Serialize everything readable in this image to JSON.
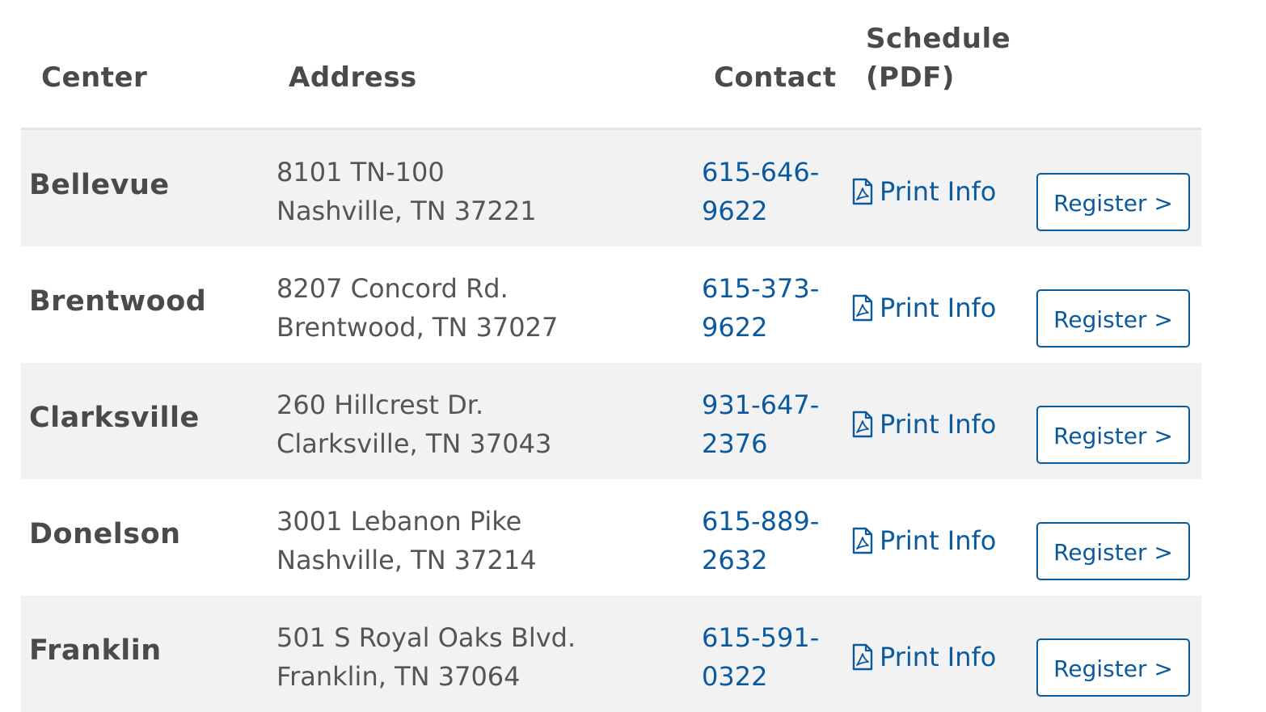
{
  "table": {
    "headers": {
      "center": "Center",
      "address": "Address",
      "contact": "Contact",
      "schedule": "Schedule (PDF)"
    },
    "rows": [
      {
        "name": "Bellevue",
        "address_line1": "8101 TN-100",
        "address_line2": "Nashville, TN 37221",
        "phone_line1": "615-646-",
        "phone_line2": "9622",
        "print_label": "Print Info",
        "register_label": "Register >"
      },
      {
        "name": "Brentwood",
        "address_line1": "8207 Concord Rd.",
        "address_line2": "Brentwood, TN 37027",
        "phone_line1": "615-373-",
        "phone_line2": "9622",
        "print_label": "Print Info",
        "register_label": "Register >"
      },
      {
        "name": "Clarksville",
        "address_line1": "260 Hillcrest Dr.",
        "address_line2": "Clarksville, TN 37043",
        "phone_line1": "931-647-",
        "phone_line2": "2376",
        "print_label": "Print Info",
        "register_label": "Register >"
      },
      {
        "name": "Donelson",
        "address_line1": "3001 Lebanon Pike",
        "address_line2": "Nashville, TN 37214",
        "phone_line1": "615-889-",
        "phone_line2": "2632",
        "print_label": "Print Info",
        "register_label": "Register >"
      },
      {
        "name": "Franklin",
        "address_line1": "501 S Royal Oaks Blvd.",
        "address_line2": "Franklin, TN 37064",
        "phone_line1": "615-591-",
        "phone_line2": "0322",
        "print_label": "Print Info",
        "register_label": "Register >"
      }
    ]
  },
  "icons": {
    "print": "pdf-file-icon"
  },
  "colors": {
    "link": "#0b5aa0",
    "heading_text": "#4a4a4a",
    "body_text": "#555555",
    "row_stripe": "#f2f2f2",
    "header_border": "#e3e3e3"
  }
}
